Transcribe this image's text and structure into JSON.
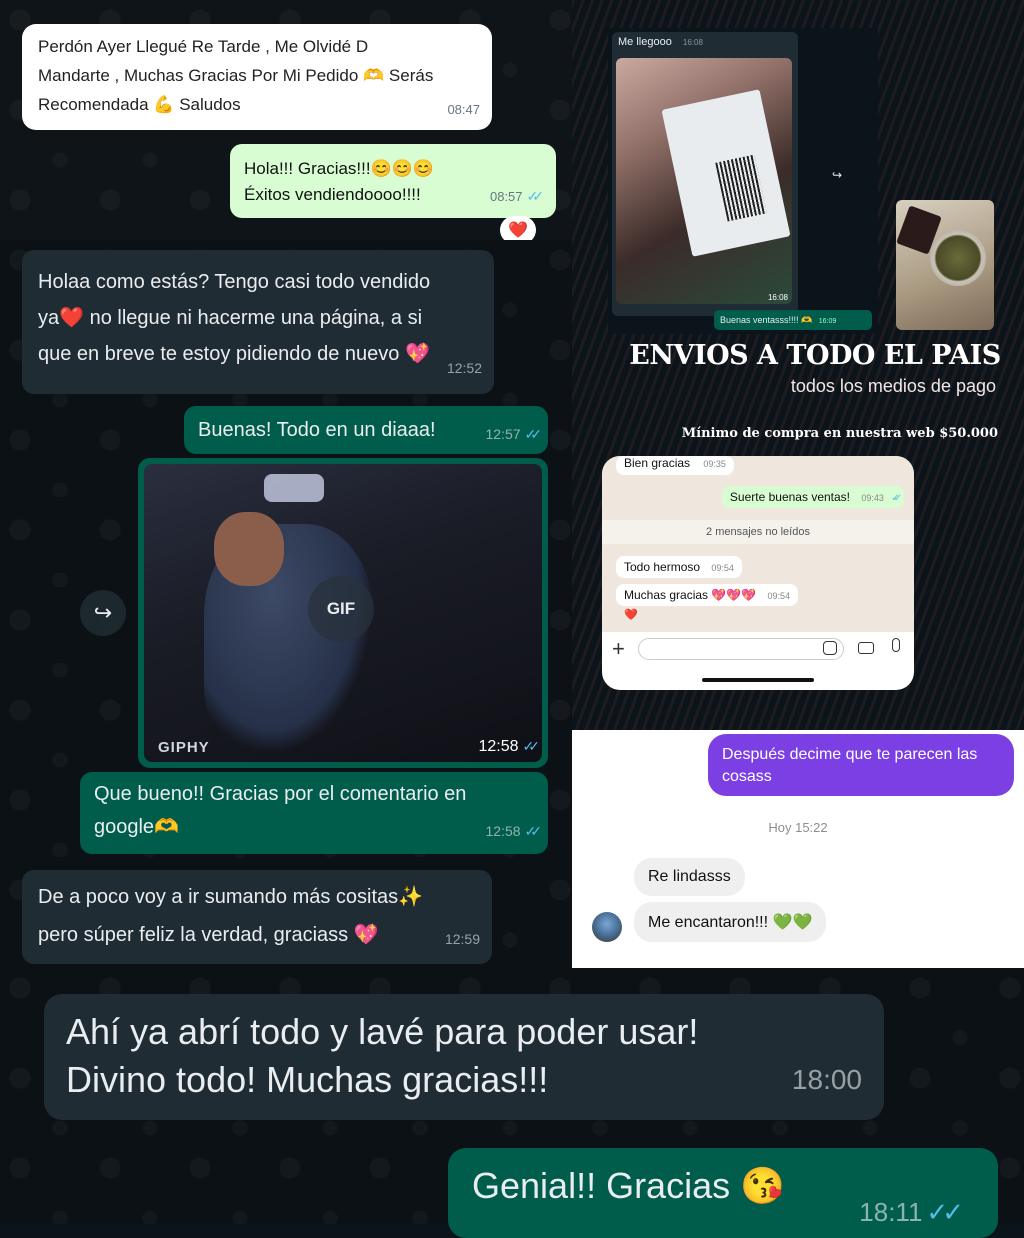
{
  "left_chat": {
    "msg1": {
      "line1": "Perdón Ayer Llegué Re Tarde , Me Olvidé D",
      "line2": "Mandarte , Muchas Gracias Por Mi Pedido 🫶 Serás",
      "line3": "Recomendada 💪 Saludos",
      "time": "08:47"
    },
    "msg2": {
      "line1": "Hola!!! Gracias!!!😊😊😊",
      "line2": "Éxitos vendiendoooo!!!!",
      "time": "08:57",
      "reaction": "❤️"
    },
    "msg3": {
      "line1": "Holaa como estás? Tengo casi todo vendido",
      "line2": "ya❤️ no llegue ni hacerme una página, a si",
      "line3": "que en breve te estoy pidiendo de nuevo 💖",
      "time": "12:52"
    },
    "msg4": {
      "text": "Buenas! Todo en un diaaa!",
      "time": "12:57"
    },
    "gif": {
      "badge": "GIF",
      "source": "GIPHY",
      "time": "12:58"
    },
    "msg5": {
      "line1": "Que bueno!! Gracias por el comentario en",
      "line2": "google🫶",
      "time": "12:58"
    },
    "msg6": {
      "line1": "De a poco voy a ir sumando más cositas✨",
      "line2": "pero súper feliz la verdad, graciass 💖",
      "time": "12:59"
    }
  },
  "promo": {
    "chat_top_in": {
      "text": "Me llegooo",
      "time": "16:08"
    },
    "photo_time": "16:08",
    "chat_top_out": {
      "text": "Buenas ventasss!!!! 🫶",
      "time": "16:09"
    },
    "headline": "ENVIOS A TODO EL PAIS",
    "subheadline": "todos los medios de pago",
    "minimum": "Mínimo de compra en nuestra web $50.000",
    "phone": {
      "in1": {
        "text": "Bien gracias",
        "time": "09:35"
      },
      "out1": {
        "text": "Suerte buenas ventas!",
        "time": "09:43"
      },
      "unread": "2 mensajes no leídos",
      "in2": {
        "text": "Todo hermoso",
        "time": "09:54"
      },
      "in3": {
        "text": "Muchas gracias 💖💖💖",
        "time": "09:54"
      },
      "reaction": "❤️"
    }
  },
  "ig": {
    "out": {
      "line1": "Después decime que te parecen las",
      "line2": "cosass"
    },
    "date": "Hoy 15:22",
    "in1": "Re lindasss",
    "in2": "Me encantaron!!! 💚💚"
  },
  "bottom_chat": {
    "msg1": {
      "line1": "Ahí ya abrí todo y lavé para poder usar!",
      "line2": "Divino todo! Muchas gracias!!!",
      "time": "18:00"
    },
    "msg2": {
      "text": "Genial!! Gracias 😘",
      "time": "18:11"
    }
  },
  "colors": {
    "wa_dark_bg": "#0b141a",
    "wa_in": "#1f2c33",
    "wa_out": "#005c4b",
    "wa_light_out": "#d9fdd3",
    "ticks": "#53bdeb",
    "ig_purple": "#7b3fe4"
  }
}
